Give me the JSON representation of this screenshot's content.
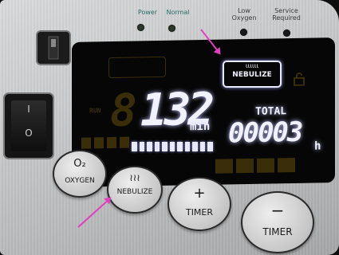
{
  "panel": {
    "indicators": [
      {
        "label": "Power"
      },
      {
        "label": "Normal"
      },
      {
        "label_line1": "Low",
        "label_line2": "Oxygen"
      },
      {
        "label_line1": "Service",
        "label_line2": "Required"
      }
    ]
  },
  "switch": {
    "on_symbol": "I",
    "off_symbol": "O"
  },
  "display": {
    "run_label": "RUN",
    "timer_value": "132",
    "timer_unit": "min",
    "total_label": "TOTAL",
    "total_value": "00003",
    "total_unit": "h",
    "nebulize_indicator": "NEBULIZE",
    "progress_segments": 11
  },
  "buttons": {
    "oxygen": "OXYGEN",
    "o2_symbol": "O₂",
    "nebulize": "NEBULIZE",
    "timer_plus": "TIMER",
    "timer_minus": "TIMER",
    "plus_symbol": "+",
    "minus_symbol": "−"
  },
  "annotations": {
    "arrow_color": "#e040c0"
  }
}
